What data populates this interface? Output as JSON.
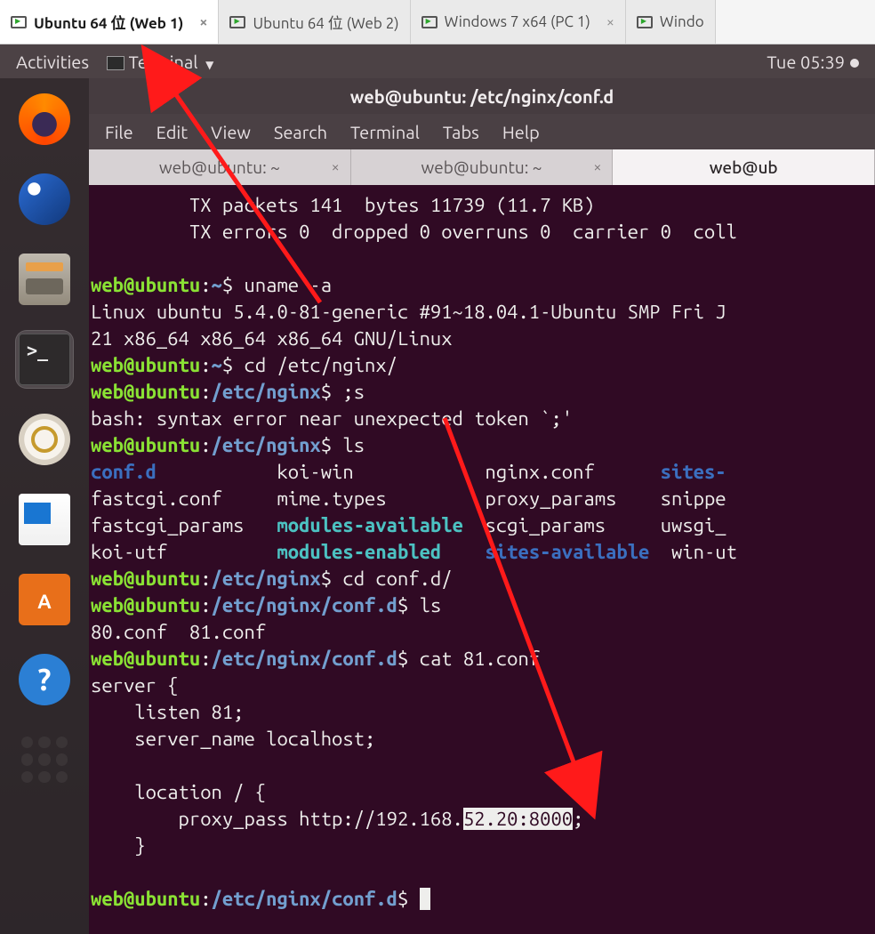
{
  "vmtabs": [
    {
      "label": "Ubuntu 64 位 (Web 1)",
      "active": true,
      "closeable": true
    },
    {
      "label": "Ubuntu 64 位 (Web 2)",
      "active": false,
      "closeable": false
    },
    {
      "label": "Windows 7 x64 (PC 1)",
      "active": false,
      "closeable": true
    },
    {
      "label": "Windo",
      "active": false,
      "closeable": false
    }
  ],
  "gnome": {
    "activities": "Activities",
    "app_name": "Terminal",
    "clock": "Tue 05:39"
  },
  "dock": {
    "items": [
      {
        "name": "firefox-icon"
      },
      {
        "name": "thunderbird-icon"
      },
      {
        "name": "files-icon"
      },
      {
        "name": "terminal-app-icon",
        "active": true
      },
      {
        "name": "rhythmbox-icon"
      },
      {
        "name": "libreoffice-writer-icon"
      },
      {
        "name": "ubuntu-software-icon"
      },
      {
        "name": "help-icon"
      },
      {
        "name": "app-grid-icon"
      }
    ]
  },
  "window": {
    "title": "web@ubuntu: /etc/nginx/conf.d",
    "menu": [
      "File",
      "Edit",
      "View",
      "Search",
      "Terminal",
      "Tabs",
      "Help"
    ],
    "tabs": [
      {
        "label": "web@ubuntu: ~",
        "active": false
      },
      {
        "label": "web@ubuntu: ~",
        "active": false
      },
      {
        "label": "web@ub",
        "active": true
      }
    ]
  },
  "term": {
    "net1": "         TX packets 141  bytes 11739 (11.7 KB)",
    "net2": "         TX errors 0  dropped 0 overruns 0  carrier 0  coll",
    "prompt_user": "web@ubuntu",
    "home": "~",
    "path_nginx": "/etc/nginx",
    "path_confd": "/etc/nginx/conf.d",
    "cmd_uname": "uname -a",
    "uname_out1": "Linux ubuntu 5.4.0-81-generic #91~18.04.1-Ubuntu SMP Fri J",
    "uname_out2": "21 x86_64 x86_64 x86_64 GNU/Linux",
    "cmd_cd1": "cd /etc/nginx/",
    "cmd_bad": ";s",
    "bash_err": "bash: syntax error near unexpected token `;'",
    "cmd_ls": "ls",
    "ls_r1": {
      "c1": "conf.d",
      "c2": "koi-win",
      "c3": "nginx.conf",
      "c4": "sites-"
    },
    "ls_r2": {
      "c1": "fastcgi.conf",
      "c2": "mime.types",
      "c3": "proxy_params",
      "c4": "snippe"
    },
    "ls_r3": {
      "c1": "fastcgi_params",
      "c2": "modules-available",
      "c3": "scgi_params",
      "c4": "uwsgi_"
    },
    "ls_r4": {
      "c1": "koi-utf",
      "c2": "modules-enabled",
      "c3": "sites-available",
      "c4": "win-ut"
    },
    "cmd_cd2": "cd conf.d/",
    "ls2": "80.conf  81.conf",
    "cmd_cat": "cat 81.conf",
    "cat1": "server {",
    "cat2": "    listen 81;",
    "cat3": "    server_name localhost;",
    "cat4": "    location / {",
    "cat5a": "        proxy_pass http://192.168.",
    "cat5b": "52.20:8000",
    "cat5c": ";",
    "cat6": "    }",
    "cursor": " "
  }
}
